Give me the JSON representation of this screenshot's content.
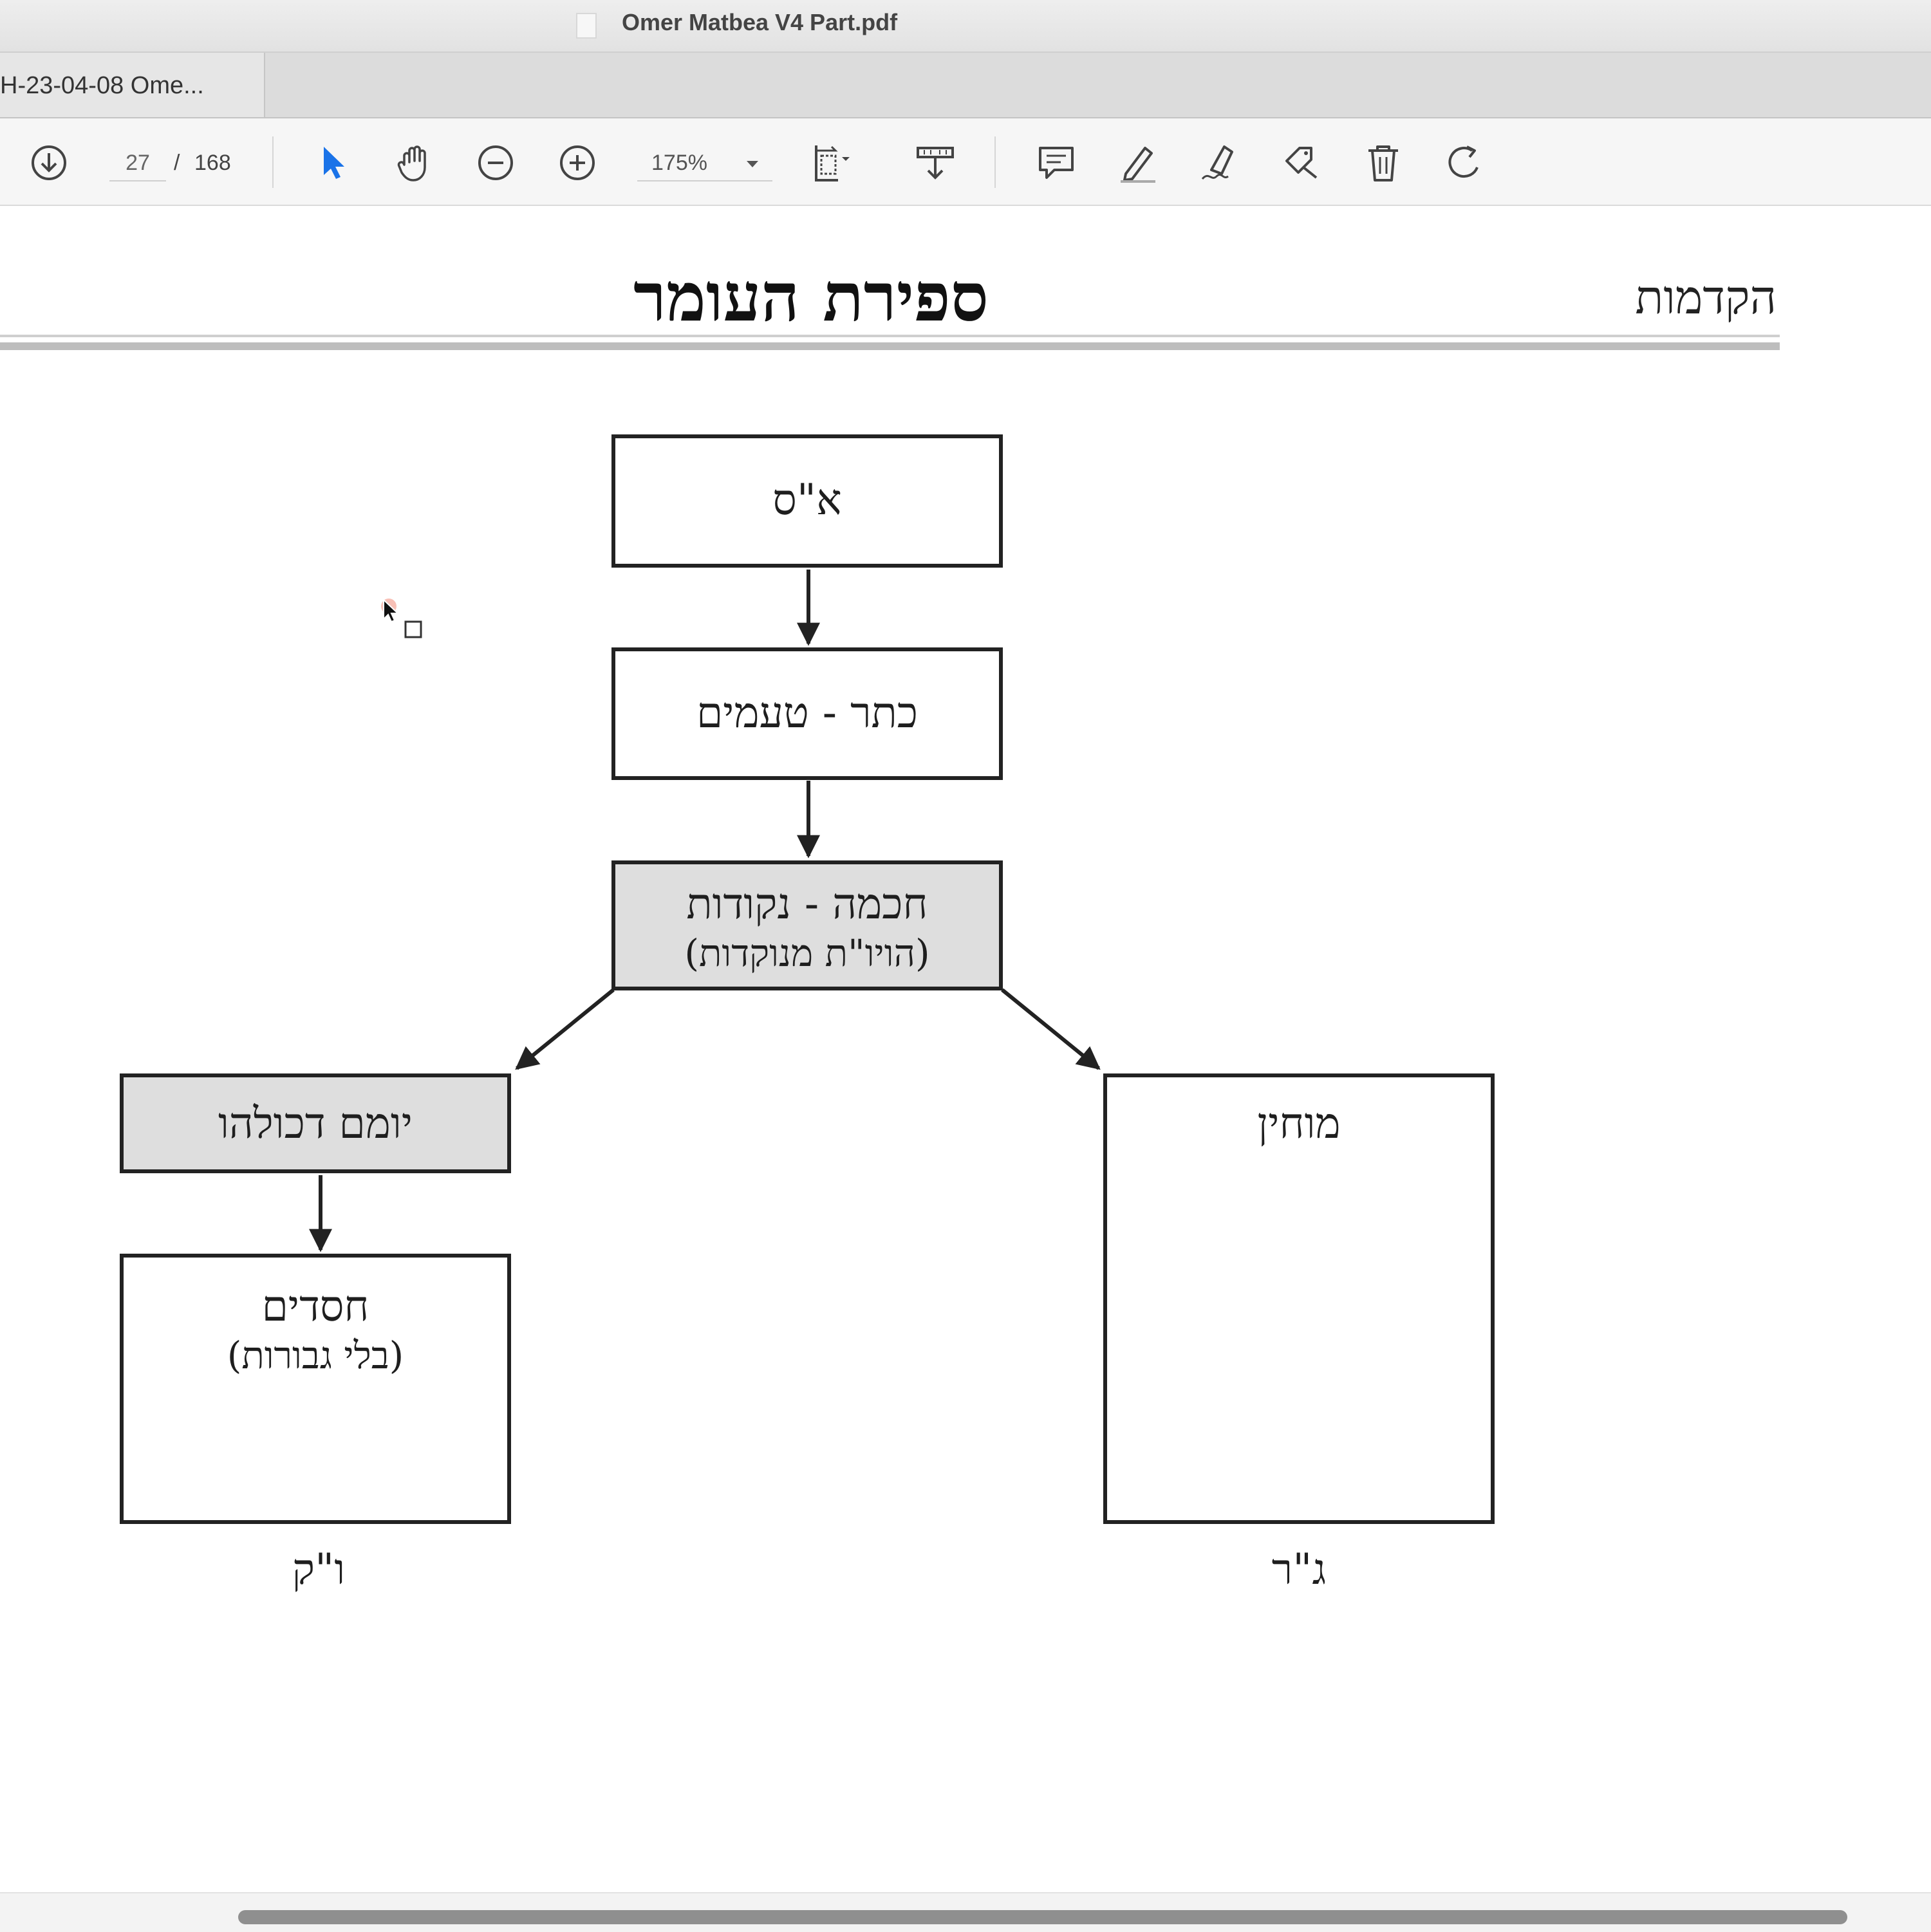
{
  "window": {
    "title": "Omer Matbea V4 Part.pdf"
  },
  "tabs": [
    {
      "label": "H-23-04-08 Ome..."
    }
  ],
  "toolbar": {
    "page_current": "27",
    "page_separator": "/",
    "page_total": "168",
    "zoom": "175%"
  },
  "document": {
    "header_right": "הקדמות",
    "title": "ספירת העומר",
    "diagram": {
      "nodes": [
        {
          "id": "ein-sof",
          "lines": [
            "א\"ס"
          ],
          "shaded": false
        },
        {
          "id": "keter",
          "lines": [
            "כתר - טעמים"
          ],
          "shaded": false
        },
        {
          "id": "chochma",
          "lines": [
            "חכמה - נקודות",
            "(הויו\"ת מנוקדות)"
          ],
          "shaded": true
        },
        {
          "id": "yomam",
          "lines": [
            "יומם דכולהו"
          ],
          "shaded": true
        },
        {
          "id": "chassadim",
          "lines": [
            "חסדים",
            "(בלי גבורות)"
          ],
          "shaded": false
        },
        {
          "id": "mochin",
          "lines": [
            "מוחין"
          ],
          "shaded": false
        }
      ],
      "edges": [
        {
          "from": "ein-sof",
          "to": "keter"
        },
        {
          "from": "keter",
          "to": "chochma"
        },
        {
          "from": "chochma",
          "to": "yomam"
        },
        {
          "from": "chochma",
          "to": "mochin"
        },
        {
          "from": "yomam",
          "to": "chassadim"
        }
      ],
      "captions": {
        "left": "ו\"ק",
        "right": "ג\"ר"
      }
    }
  },
  "colors": {
    "selection_arrow": "#1a73e8",
    "shaded_box": "#dedede"
  }
}
